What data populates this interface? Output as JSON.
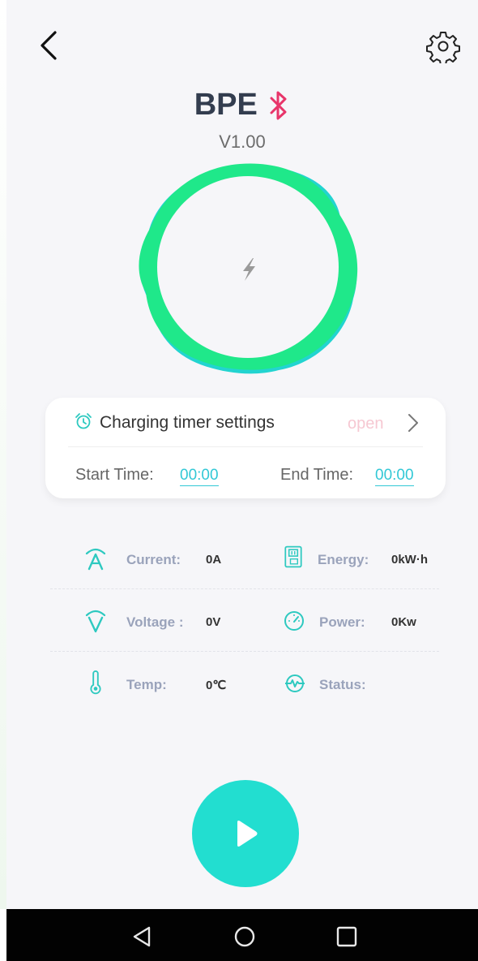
{
  "header": {
    "title": "BPE",
    "version": "V1.00"
  },
  "timer_card": {
    "title": "Charging timer settings",
    "status": "open",
    "start_label": "Start Time:",
    "start_value": "00:00",
    "end_label": "End Time:",
    "end_value": "00:00"
  },
  "stats": {
    "current_label": "Current:",
    "current_value": "0A",
    "energy_label": "Energy:",
    "energy_value": "0kW·h",
    "voltage_label": "Voltage :",
    "voltage_value": "0V",
    "power_label": "Power:",
    "power_value": "0Kw",
    "temp_label": "Temp:",
    "temp_value": "0℃",
    "status_label": "Status:",
    "status_value": ""
  },
  "colors": {
    "accent": "#22ded0",
    "ring_green": "#1fe88a",
    "ring_teal": "#22d4d0",
    "bluetooth": "#e8356a",
    "icon_teal": "#2ec9c0"
  },
  "icons": {
    "back": "back-chevron-icon",
    "settings": "gear-icon",
    "bluetooth": "bluetooth-icon",
    "charge": "lightning-icon",
    "alarm": "alarm-clock-icon",
    "play": "play-icon"
  }
}
